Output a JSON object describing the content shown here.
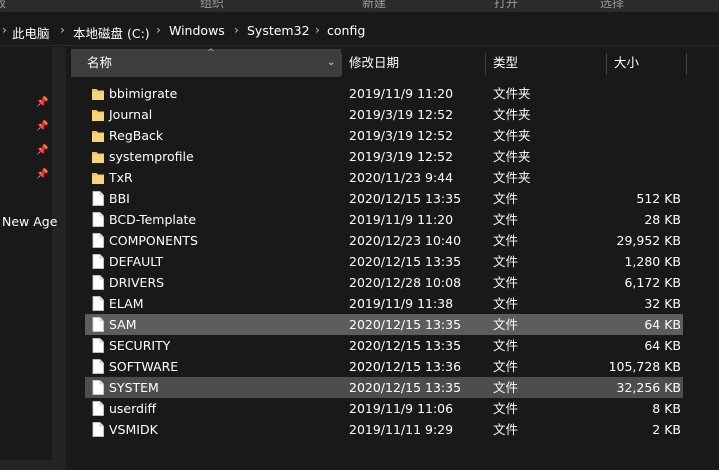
{
  "ribbon": {
    "items": [
      "板",
      "组织",
      "新建",
      "打开",
      "选择"
    ]
  },
  "address": {
    "crumbs": [
      "此电脑",
      "本地磁盘 (C:)",
      "Windows",
      "System32",
      "config"
    ]
  },
  "nav": {
    "partial_label": "New Age"
  },
  "columns": {
    "name": "名称",
    "date": "修改日期",
    "type": "类型",
    "size": "大小"
  },
  "files": [
    {
      "name": "bbimigrate",
      "date": "2019/11/9 11:20",
      "type": "文件夹",
      "size": "",
      "kind": "folder"
    },
    {
      "name": "Journal",
      "date": "2019/3/19 12:52",
      "type": "文件夹",
      "size": "",
      "kind": "folder"
    },
    {
      "name": "RegBack",
      "date": "2019/3/19 12:52",
      "type": "文件夹",
      "size": "",
      "kind": "folder"
    },
    {
      "name": "systemprofile",
      "date": "2019/3/19 12:52",
      "type": "文件夹",
      "size": "",
      "kind": "folder"
    },
    {
      "name": "TxR",
      "date": "2020/11/23 9:44",
      "type": "文件夹",
      "size": "",
      "kind": "folder"
    },
    {
      "name": "BBI",
      "date": "2020/12/15 13:35",
      "type": "文件",
      "size": "512 KB",
      "kind": "file"
    },
    {
      "name": "BCD-Template",
      "date": "2019/11/9 11:20",
      "type": "文件",
      "size": "28 KB",
      "kind": "file"
    },
    {
      "name": "COMPONENTS",
      "date": "2020/12/23 10:40",
      "type": "文件",
      "size": "29,952 KB",
      "kind": "file"
    },
    {
      "name": "DEFAULT",
      "date": "2020/12/15 13:35",
      "type": "文件",
      "size": "1,280 KB",
      "kind": "file"
    },
    {
      "name": "DRIVERS",
      "date": "2020/12/28 10:08",
      "type": "文件",
      "size": "6,172 KB",
      "kind": "file"
    },
    {
      "name": "ELAM",
      "date": "2019/11/9 11:38",
      "type": "文件",
      "size": "32 KB",
      "kind": "file"
    },
    {
      "name": "SAM",
      "date": "2020/12/15 13:35",
      "type": "文件",
      "size": "64 KB",
      "kind": "file",
      "selected": true
    },
    {
      "name": "SECURITY",
      "date": "2020/12/15 13:35",
      "type": "文件",
      "size": "64 KB",
      "kind": "file"
    },
    {
      "name": "SOFTWARE",
      "date": "2020/12/15 13:36",
      "type": "文件",
      "size": "105,728 KB",
      "kind": "file"
    },
    {
      "name": "SYSTEM",
      "date": "2020/12/15 13:35",
      "type": "文件",
      "size": "32,256 KB",
      "kind": "file",
      "selected": true
    },
    {
      "name": "userdiff",
      "date": "2019/11/9 11:06",
      "type": "文件",
      "size": "8 KB",
      "kind": "file"
    },
    {
      "name": "VSMIDK",
      "date": "2019/11/11 9:29",
      "type": "文件",
      "size": "2 KB",
      "kind": "file"
    }
  ],
  "colors": {
    "background": "#191919",
    "header": "#3d3d3d",
    "selection": "#5d5d5d",
    "folder": "#f2c55c"
  }
}
